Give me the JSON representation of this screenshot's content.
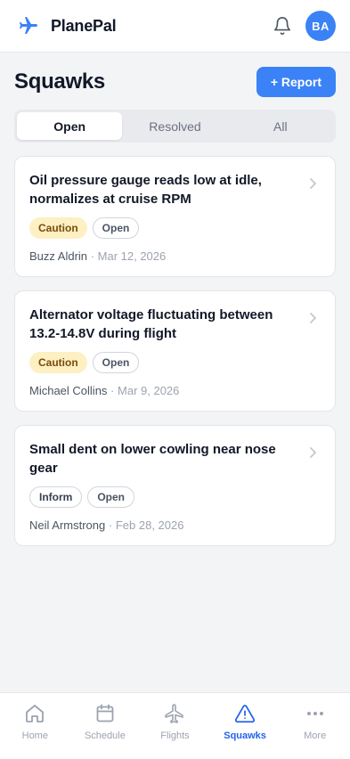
{
  "app": {
    "name": "PlanePal",
    "avatar_initials": "BA",
    "accent": "#3b82f6"
  },
  "page": {
    "title": "Squawks",
    "report_label": "+ Report"
  },
  "tabs": [
    {
      "label": "Open",
      "active": true
    },
    {
      "label": "Resolved",
      "active": false
    },
    {
      "label": "All",
      "active": false
    }
  ],
  "squawks": [
    {
      "title": "Oil pressure gauge reads low at idle, normalizes at cruise RPM",
      "severity": "Caution",
      "status": "Open",
      "author": "Buzz Aldrin",
      "separator": "·",
      "date": "Mar 12, 2026"
    },
    {
      "title": "Alternator voltage fluctuating between 13.2-14.8V during flight",
      "severity": "Caution",
      "status": "Open",
      "author": "Michael Collins",
      "separator": "·",
      "date": "Mar 9, 2026"
    },
    {
      "title": "Small dent on lower cowling near nose gear",
      "severity": "Inform",
      "status": "Open",
      "author": "Neil Armstrong",
      "separator": "·",
      "date": "Feb 28, 2026"
    }
  ],
  "nav": [
    {
      "label": "Home",
      "icon": "home-icon",
      "active": false
    },
    {
      "label": "Schedule",
      "icon": "calendar-icon",
      "active": false
    },
    {
      "label": "Flights",
      "icon": "airplane-icon",
      "active": false
    },
    {
      "label": "Squawks",
      "icon": "warning-icon",
      "active": true
    },
    {
      "label": "More",
      "icon": "more-icon",
      "active": false
    }
  ]
}
